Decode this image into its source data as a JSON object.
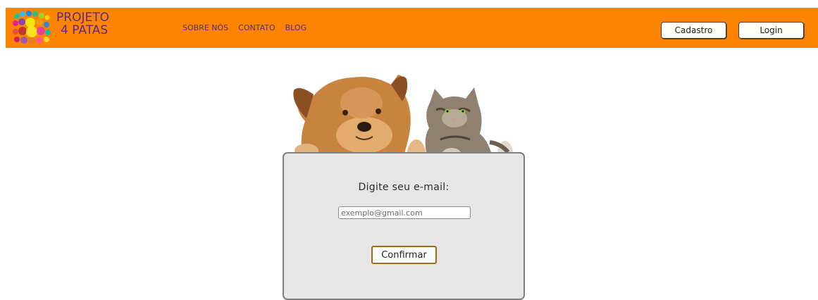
{
  "header": {
    "logo_line1": "PROJETO",
    "logo_line2": "4 PATAS",
    "nav": [
      "SOBRE NÓS",
      "CONTATO",
      "BLOG"
    ],
    "register_label": "Cadastro",
    "login_label": "Login"
  },
  "form": {
    "prompt": "Digite seu e-mail:",
    "email_placeholder": "exemplo@gmail.com",
    "email_value": "",
    "confirm_label": "Confirmar"
  },
  "colors": {
    "navbar": "#fd8401",
    "logo_text": "#5a2a86",
    "card_bg": "#e6e6e6",
    "confirm_border": "#a36a16"
  }
}
